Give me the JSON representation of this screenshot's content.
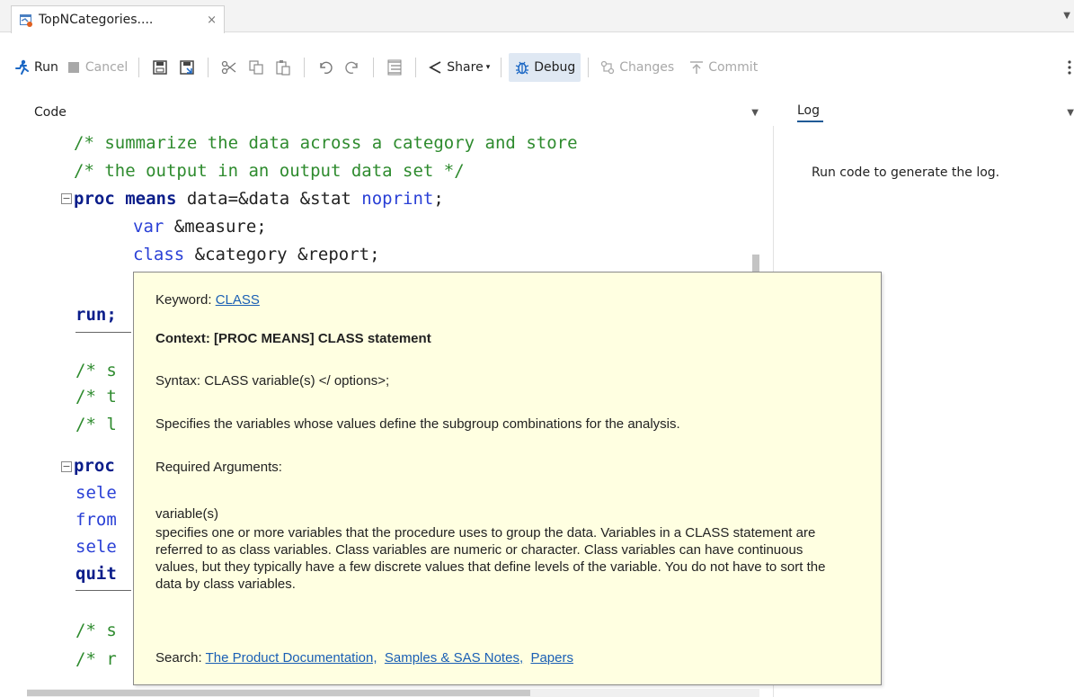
{
  "tab": {
    "title": "TopNCategories....",
    "close": "×"
  },
  "toolbar": {
    "run": "Run",
    "cancel": "Cancel",
    "share": "Share",
    "debug": "Debug",
    "changes": "Changes",
    "commit": "Commit"
  },
  "panes": {
    "code": "Code",
    "log": "Log"
  },
  "code": {
    "line1": "/* summarize the data across a category and store",
    "line2": "/* the output in an output data set */",
    "line3_kw": "proc means",
    "line3_mid": " data=&data &stat ",
    "line3_opt": "noprint",
    "line3_end": ";",
    "line4_kw": "var",
    "line4_rest": " &measure;",
    "line5_kw": "class",
    "line5_rest": " &category &report;",
    "line6": "run;",
    "line7": "/* s",
    "line8": "/* t",
    "line9": "/* l",
    "line10": "proc",
    "line11": "sele",
    "line12": "from",
    "line13": "sele",
    "line14": "quit",
    "line15": "/* s",
    "line16": "/* r"
  },
  "log": {
    "message": "Run code to generate the log."
  },
  "tooltip": {
    "keyword_label": "Keyword: ",
    "keyword": "CLASS",
    "context": "Context: [PROC MEANS] CLASS statement",
    "syntax": "Syntax: CLASS variable(s) </ options>;",
    "specifies": "Specifies the variables whose values define the subgroup combinations for the analysis.",
    "required": "Required Arguments:",
    "arg_name": "variable(s)",
    "arg_desc": "specifies one or more variables that the procedure uses to group the data. Variables in a CLASS statement are referred to as class variables. Class variables are numeric or character. Class variables can have continuous values, but they typically have a few discrete values that define levels of the variable. You do not have to sort the data by class variables.",
    "search_label": "Search: ",
    "links": [
      "The Product Documentation,",
      "Samples & SAS Notes,",
      "Papers"
    ]
  },
  "colors": {
    "comment": "#2e8b2e",
    "keyword": "#0a1d8a",
    "tooltip_bg": "#ffffe1",
    "link": "#1a5fb4"
  }
}
